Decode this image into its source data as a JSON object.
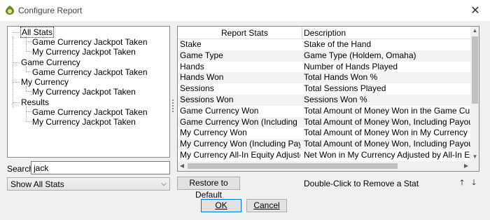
{
  "window": {
    "title": "Configure Report",
    "close_glyph": "✕"
  },
  "tree": {
    "items": [
      {
        "label": "All Stats",
        "level": 0
      },
      {
        "label": "Game Currency Jackpot Taken",
        "level": 1
      },
      {
        "label": "My Currency Jackpot Taken",
        "level": 1
      },
      {
        "label": "Game Currency",
        "level": 0
      },
      {
        "label": "Game Currency Jackpot Taken",
        "level": 1
      },
      {
        "label": "My Currency",
        "level": 0
      },
      {
        "label": "My Currency Jackpot Taken",
        "level": 1
      },
      {
        "label": "Results",
        "level": 0
      },
      {
        "label": "Game Currency Jackpot Taken",
        "level": 1
      },
      {
        "label": "My Currency Jackpot Taken",
        "level": 1
      }
    ]
  },
  "search": {
    "label": "Search:",
    "value": "jack"
  },
  "filter": {
    "selected": "Show All Stats",
    "arrow": "⌵"
  },
  "table": {
    "headers": [
      "Report Stats",
      "Description"
    ],
    "rows": [
      [
        "Stake",
        "Stake of the Hand"
      ],
      [
        "Game Type",
        "Game Type (Holdem, Omaha)"
      ],
      [
        "Hands",
        "Number of Hands Played"
      ],
      [
        "Hands Won",
        "Total Hands Won %"
      ],
      [
        "Sessions",
        "Total Sessions Played"
      ],
      [
        "Sessions Won",
        "Sessions Won %"
      ],
      [
        "Game Currency Won",
        "Total Amount of Money Won in the Game Currency"
      ],
      [
        "Game Currency Won (Including Payout)",
        "Total Amount of Money Won, Including Payouts, in the G"
      ],
      [
        "My Currency Won",
        "Total Amount of Money Won in My Currency"
      ],
      [
        "My Currency Won (Including Payouts)",
        "Total Amount of Money Won, Including Payouts, in My C"
      ],
      [
        "My Currency All-In Equity Adjusted",
        "Net Won in My Currency Adjusted by All-In Equity"
      ]
    ],
    "scroll_up": "▲",
    "scroll_down": "▼",
    "scroll_left": "◀",
    "scroll_right": "▶"
  },
  "buttons": {
    "restore_default": "Restore to Default",
    "ok": "OK",
    "cancel": "Cancel",
    "move_up": "🡑",
    "move_down": "🡓"
  },
  "hint": "Double-Click to Remove a Stat"
}
